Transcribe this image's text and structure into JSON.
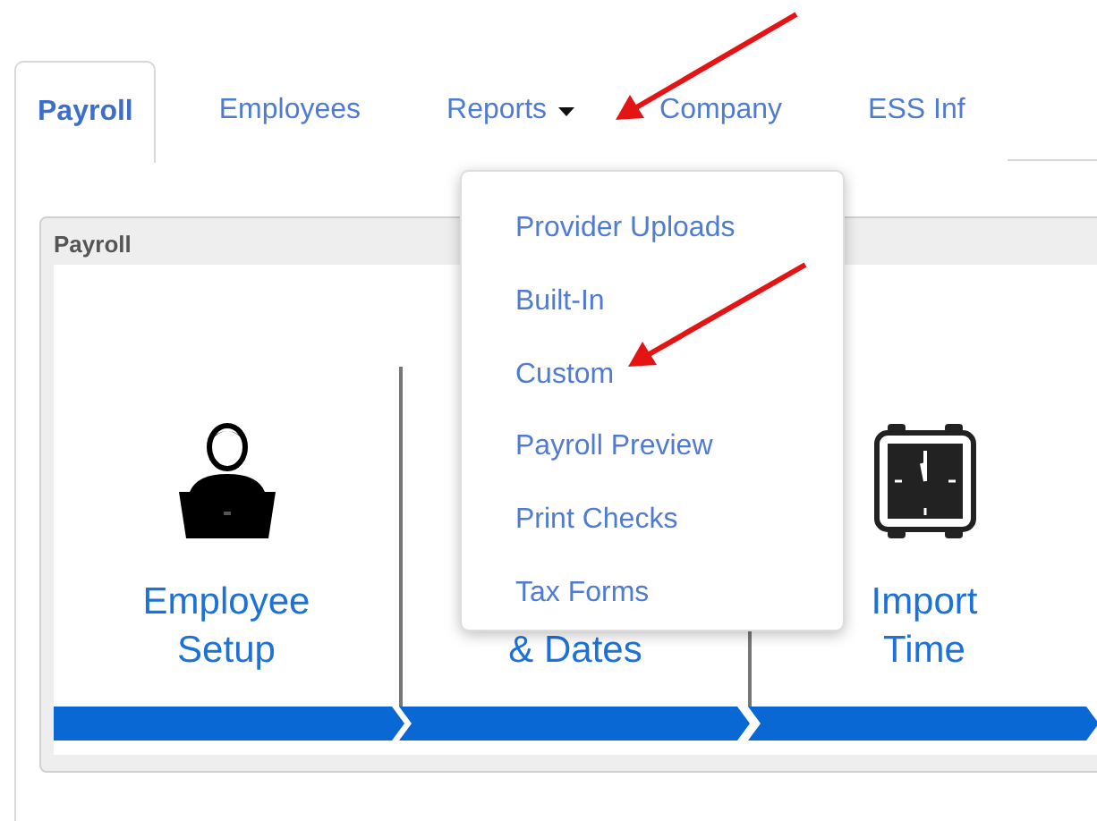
{
  "tabs": [
    {
      "label": "Payroll",
      "selected": true,
      "dropdown": false
    },
    {
      "label": "Employees",
      "selected": false,
      "dropdown": false
    },
    {
      "label": "Reports",
      "selected": false,
      "dropdown": true
    },
    {
      "label": "Company",
      "selected": false,
      "dropdown": false
    },
    {
      "label": "ESS Inf",
      "selected": false,
      "dropdown": false
    }
  ],
  "panel": {
    "title": "Payroll",
    "steps": [
      {
        "kind": "employee",
        "title": "Employee Setup"
      },
      {
        "kind": "covered",
        "title": "& Dates"
      },
      {
        "kind": "clock",
        "title": "Import Time"
      }
    ]
  },
  "reports_menu": {
    "items": [
      "Provider Uploads",
      "Built-In",
      "Custom",
      "Payroll Preview",
      "Print Checks",
      "Tax Forms"
    ]
  }
}
